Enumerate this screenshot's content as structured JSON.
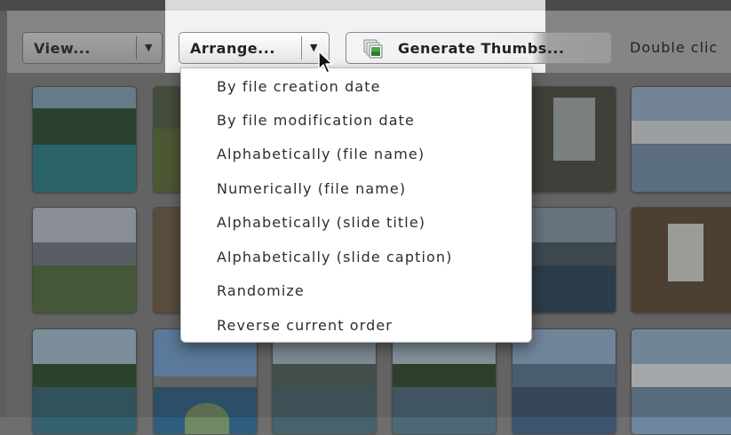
{
  "toolbar": {
    "view_label": "View...",
    "arrange_label": "Arrange...",
    "generate_label": "Generate Thumbs...",
    "hint_text": "Double clic"
  },
  "arrange_menu": {
    "items": [
      {
        "label": "By file creation date"
      },
      {
        "label": "By file modification date"
      },
      {
        "label": "Alphabetically (file name)"
      },
      {
        "label": "Numerically (file name)"
      },
      {
        "label": "Alphabetically (slide title)"
      },
      {
        "label": "Alphabetically (slide caption)"
      },
      {
        "label": "Randomize"
      },
      {
        "label": "Reverse current order"
      }
    ]
  },
  "icons": {
    "dropdown_arrow": "chevron-down-icon",
    "thumbs": "image-stack-icon",
    "pointer": "mouse-pointer-icon"
  },
  "colors": {
    "menu_bg": "#ffffff",
    "menu_text": "#2d2d2d",
    "toolbar_dim": "#858585",
    "thumb_icon_green": "#4fa84a"
  }
}
